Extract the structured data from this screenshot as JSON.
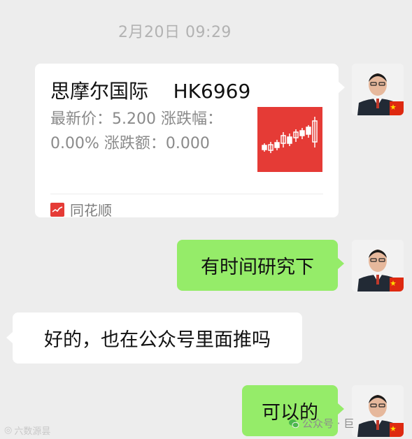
{
  "chat": {
    "timestamp": "2月20日 09:29",
    "share_card": {
      "title": "思摩尔国际    HK6969",
      "description": "最新价：5.200 涨跌幅：0.00% 涨跌额：0.000",
      "source": "同花顺",
      "thumb_color": "#e53b36"
    },
    "messages": [
      {
        "side": "right",
        "text": "有时间研究下"
      },
      {
        "side": "left",
        "text": "好的，也在公众号里面推吗"
      },
      {
        "side": "right",
        "text": "可以的"
      }
    ]
  },
  "watermarks": {
    "left": "六数源昙",
    "right": "公众号 · 巨"
  },
  "colors": {
    "background": "#ededed",
    "outgoing_bubble": "#95ec69",
    "incoming_bubble": "#ffffff",
    "timestamp": "#b2b2b2"
  }
}
